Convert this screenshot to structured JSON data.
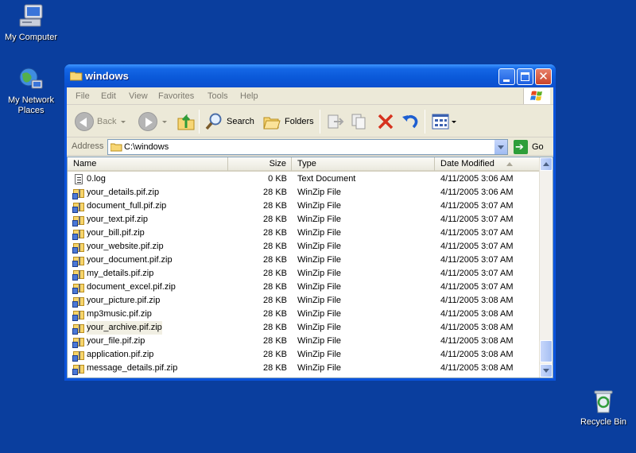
{
  "desktop": {
    "icons": [
      {
        "label": "My Computer"
      },
      {
        "label": "My Network Places"
      },
      {
        "label": "Recycle Bin"
      }
    ]
  },
  "window": {
    "title": "windows",
    "menu": [
      "File",
      "Edit",
      "View",
      "Favorites",
      "Tools",
      "Help"
    ],
    "toolbar": {
      "back": "Back",
      "search": "Search",
      "folders": "Folders"
    },
    "address": {
      "label": "Address",
      "value": "C:\\windows",
      "go": "Go"
    },
    "columns": {
      "name": "Name",
      "size": "Size",
      "type": "Type",
      "date": "Date Modified"
    },
    "files": [
      {
        "name": "0.log",
        "size": "0 KB",
        "type": "Text Document",
        "date": "4/11/2005 3:06 AM",
        "icon": "text-file-icon"
      },
      {
        "name": "your_details.pif.zip",
        "size": "28 KB",
        "type": "WinZip File",
        "date": "4/11/2005 3:06 AM",
        "icon": "zip-file-icon"
      },
      {
        "name": "document_full.pif.zip",
        "size": "28 KB",
        "type": "WinZip File",
        "date": "4/11/2005 3:07 AM",
        "icon": "zip-file-icon"
      },
      {
        "name": "your_text.pif.zip",
        "size": "28 KB",
        "type": "WinZip File",
        "date": "4/11/2005 3:07 AM",
        "icon": "zip-file-icon"
      },
      {
        "name": "your_bill.pif.zip",
        "size": "28 KB",
        "type": "WinZip File",
        "date": "4/11/2005 3:07 AM",
        "icon": "zip-file-icon"
      },
      {
        "name": "your_website.pif.zip",
        "size": "28 KB",
        "type": "WinZip File",
        "date": "4/11/2005 3:07 AM",
        "icon": "zip-file-icon"
      },
      {
        "name": "your_document.pif.zip",
        "size": "28 KB",
        "type": "WinZip File",
        "date": "4/11/2005 3:07 AM",
        "icon": "zip-file-icon"
      },
      {
        "name": "my_details.pif.zip",
        "size": "28 KB",
        "type": "WinZip File",
        "date": "4/11/2005 3:07 AM",
        "icon": "zip-file-icon"
      },
      {
        "name": "document_excel.pif.zip",
        "size": "28 KB",
        "type": "WinZip File",
        "date": "4/11/2005 3:07 AM",
        "icon": "zip-file-icon"
      },
      {
        "name": "your_picture.pif.zip",
        "size": "28 KB",
        "type": "WinZip File",
        "date": "4/11/2005 3:08 AM",
        "icon": "zip-file-icon"
      },
      {
        "name": "mp3music.pif.zip",
        "size": "28 KB",
        "type": "WinZip File",
        "date": "4/11/2005 3:08 AM",
        "icon": "zip-file-icon"
      },
      {
        "name": "your_archive.pif.zip",
        "size": "28 KB",
        "type": "WinZip File",
        "date": "4/11/2005 3:08 AM",
        "icon": "zip-file-icon"
      },
      {
        "name": "your_file.pif.zip",
        "size": "28 KB",
        "type": "WinZip File",
        "date": "4/11/2005 3:08 AM",
        "icon": "zip-file-icon"
      },
      {
        "name": "application.pif.zip",
        "size": "28 KB",
        "type": "WinZip File",
        "date": "4/11/2005 3:08 AM",
        "icon": "zip-file-icon"
      },
      {
        "name": "message_details.pif.zip",
        "size": "28 KB",
        "type": "WinZip File",
        "date": "4/11/2005 3:08 AM",
        "icon": "zip-file-icon"
      }
    ]
  },
  "colors": {
    "desktop": "#0a3e9e",
    "titlebar": "#0a58d8",
    "window_face": "#ece9d8"
  }
}
